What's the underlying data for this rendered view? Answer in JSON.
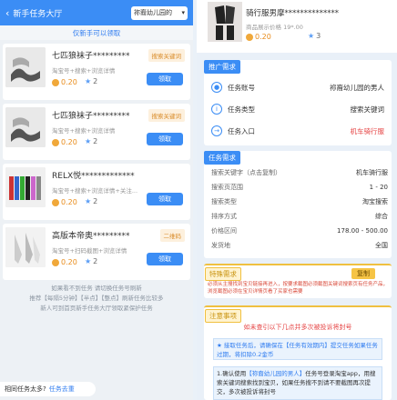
{
  "left": {
    "title": "新手任务大厅",
    "dropdown_value": "祢裔幼儿园的",
    "notice": "仅新手可以领取",
    "cards": [
      {
        "title": "七匹狼袜子*********",
        "tag": "搜索关键词",
        "sub": "淘宝号+搜索+浏览详情",
        "price": "0.20",
        "stars": "2",
        "button": "领取"
      },
      {
        "title": "七匹狼袜子*********",
        "tag": "搜索关键词",
        "sub": "淘宝号+搜索+浏览详情",
        "price": "0.20",
        "stars": "2",
        "button": "领取"
      },
      {
        "title": "RELX悦*************",
        "tag": "",
        "sub": "淘宝号+搜索+浏览详情+关注...",
        "price": "0.20",
        "stars": "2",
        "button": "领取"
      },
      {
        "title": "高版本帝奥*********",
        "tag": "二维码",
        "sub": "淘宝号+扫码截图+浏览详情",
        "price": "0.20",
        "stars": "2",
        "button": "领取"
      }
    ],
    "footer_lines": [
      "如果看不到任务 请切换任务号刷新",
      "推荐【每隔5分钟】【半点】【整点】刷新任务比较多",
      "新人可到首页新手任务大厅领取紧保护任务"
    ],
    "help_text": "相同任务太多?",
    "help_link": "任务去重"
  },
  "right": {
    "product_title": "骑行服男摩**************",
    "product_sub": "商品展示价格 19*.00",
    "product_price": "0.20",
    "product_stars": "3",
    "promo_head": "推广需求",
    "info_rows": [
      {
        "icon": "user-icon",
        "label": "任务账号",
        "value": "祢裔幼儿园的男人",
        "red": false
      },
      {
        "icon": "info-icon",
        "label": "任务类型",
        "value": "搜索关键词",
        "red": false
      },
      {
        "icon": "enter-icon",
        "label": "任务入口",
        "value": "机车骑行服",
        "red": true
      }
    ],
    "task_head": "任务需求",
    "task_rows": [
      {
        "label": "搜索关键字（点击复制）",
        "value": "机车骑行服",
        "red": true
      },
      {
        "label": "搜索页范围",
        "value": "1 - 20",
        "red": false
      },
      {
        "label": "搜索类型",
        "value": "淘宝搜索",
        "red": false
      },
      {
        "label": "排序方式",
        "value": "综合",
        "red": false
      },
      {
        "label": "价格区间",
        "value": "178.00 - 500.00",
        "red": false
      },
      {
        "label": "发货地",
        "value": "全国",
        "red": false
      }
    ],
    "special_head": "特殊需求",
    "copy_button": "复制",
    "special_text": "必须从主搜找到宝贝链接再进入，按要求截图必须截图关键词搜索页有任务产品，浏览截图必须在宝贝详情页看了买家也需要",
    "notes_head": "注意事项",
    "notes_red": "如未查引以下几点并多次被投诉将封号",
    "note1": "★ 接取任务后，请确保在【任务有效期内】提交任务如果任务过期，将扣除0.2金币",
    "note2_a": "1.确认使用",
    "note2_b": "【祢裔幼儿园的男人】",
    "note2_c": "任务号登录淘宝app，用搜索关键词搜索找到宝贝，如果任务搜不到请不要截图再次提交，多次被投诉将封号"
  }
}
